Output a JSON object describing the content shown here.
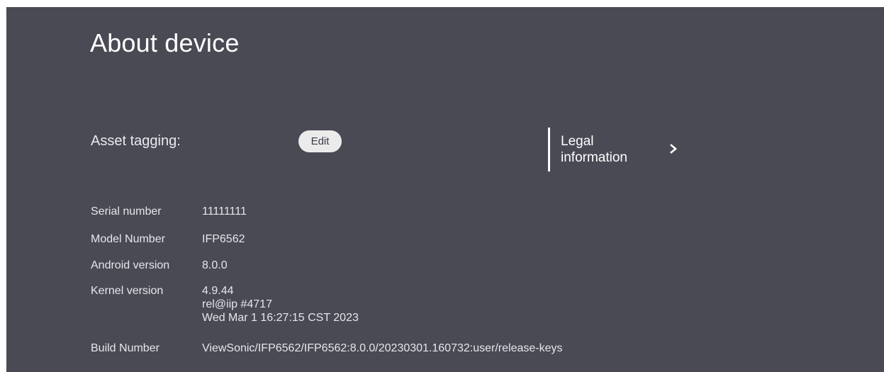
{
  "page": {
    "title": "About device"
  },
  "asset_tagging": {
    "label": "Asset tagging:",
    "edit_label": "Edit"
  },
  "legal": {
    "line1": "Legal",
    "line2": "information",
    "icon": "chevron-right-icon"
  },
  "info": {
    "serial_label": "Serial number",
    "serial_value": "11111111",
    "model_label": "Model Number",
    "model_value": "IFP6562",
    "android_label": "Android version",
    "android_value": "8.0.0",
    "kernel_label": "Kernel version",
    "kernel_value_1": "4.9.44",
    "kernel_value_2": "rel@iip #4717",
    "kernel_value_3": "Wed Mar 1 16:27:15 CST 2023",
    "build_label": "Build Number",
    "build_value": "ViewSonic/IFP6562/IFP6562:8.0.0/20230301.160732:user/release-keys"
  },
  "colors": {
    "panel_background": "#4a4a55",
    "button_background": "#ebebeb",
    "text": "#ffffff"
  }
}
